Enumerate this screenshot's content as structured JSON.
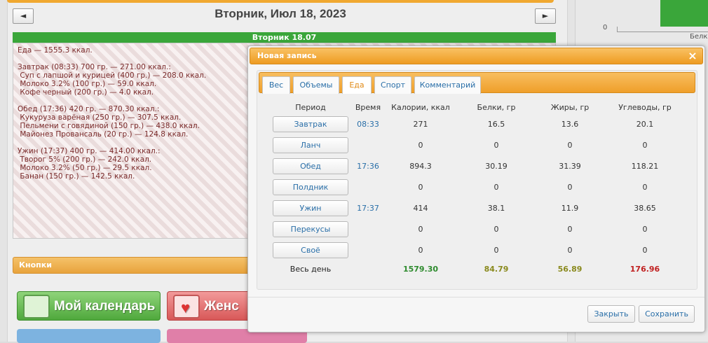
{
  "background": {
    "date_title": "Вторник, Июл 18, 2023",
    "prev_label": "◄",
    "next_label": "►",
    "day_bar": "Вторник 18.07",
    "day_lines": [
      "Еда — 1555.3 ккал.",
      "",
      "Завтрак (08:33) 700 гр. — 271.00 ккал.:",
      " Суп с лапшой и курицей (400 гр.) — 208.0 ккал.",
      " Молоко 3.2% (100 гр.) — 59.0 ккал.",
      " Кофе черный (200 гр.) — 4.0 ккал.",
      "",
      "Обед (17:36) 420 гр. — 870.30 ккал.:",
      " Кукуруза варёная (250 гр.) — 307.5 ккал.",
      " Пельмени с говядиной (150 гр.) — 438.0 ккал.",
      " Майонез Провансаль (20 гр.) — 124.8 ккал.",
      "",
      "Ужин (17:37) 400 гр. — 414.00 ккал.:",
      " Творог 5% (200 гр.) — 242.0 ккал.",
      " Молоко 3.2% (50 гр.) — 29.5 ккал.",
      " Банан (150 гр.) — 142.5 ккал."
    ],
    "knopki": "Кнопки",
    "calendar_btn": "Мой календарь",
    "red_btn": "Женс",
    "axis_zero": "0",
    "axis_belki": "Белки"
  },
  "modal": {
    "title": "Новая запись",
    "close_glyph": "×",
    "tabs": [
      "Вес",
      "Объемы",
      "Еда",
      "Спорт",
      "Комментарий"
    ],
    "active_tab": "Еда",
    "headers": {
      "period": "Период",
      "time": "Время",
      "calories": "Калории, ккал",
      "protein": "Белки, гр",
      "fat": "Жиры, гр",
      "carbs": "Углеводы, гр"
    },
    "rows": [
      {
        "period": "Завтрак",
        "time": "08:33",
        "calories": "271",
        "protein": "16.5",
        "fat": "13.6",
        "carbs": "20.1"
      },
      {
        "period": "Ланч",
        "time": "",
        "calories": "0",
        "protein": "0",
        "fat": "0",
        "carbs": "0"
      },
      {
        "period": "Обед",
        "time": "17:36",
        "calories": "894.3",
        "protein": "30.19",
        "fat": "31.39",
        "carbs": "118.21"
      },
      {
        "period": "Полдник",
        "time": "",
        "calories": "0",
        "protein": "0",
        "fat": "0",
        "carbs": "0"
      },
      {
        "period": "Ужин",
        "time": "17:37",
        "calories": "414",
        "protein": "38.1",
        "fat": "11.9",
        "carbs": "38.65"
      },
      {
        "period": "Перекусы",
        "time": "",
        "calories": "0",
        "protein": "0",
        "fat": "0",
        "carbs": "0"
      },
      {
        "period": "Своё",
        "time": "",
        "calories": "0",
        "protein": "0",
        "fat": "0",
        "carbs": "0"
      }
    ],
    "totals": {
      "label": "Весь день",
      "calories": "1579.30",
      "protein": "84.79",
      "fat": "56.89",
      "carbs": "176.96"
    },
    "total_colors": {
      "calories": "#2e8b2e",
      "protein": "#8a8a1e",
      "fat": "#8a8a1e",
      "carbs": "#c02020"
    },
    "close_btn": "Закрыть",
    "save_btn": "Сохранить"
  }
}
